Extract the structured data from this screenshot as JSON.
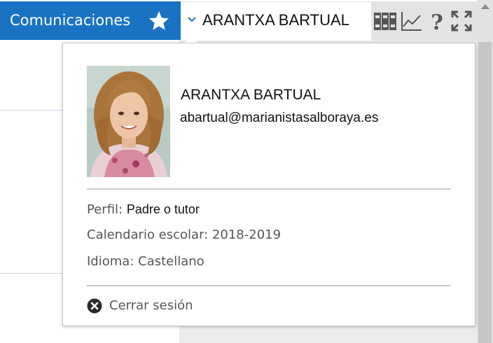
{
  "header": {
    "module_title": "Comunicaciones",
    "user_name": "ARANTXA BARTUAL",
    "colors": {
      "accent": "#1a72c3",
      "toolbar_bg": "#e3e3e3"
    },
    "icons": [
      "star-icon",
      "chevron-down-icon",
      "library-icon",
      "chart-icon",
      "help-icon",
      "fullscreen-icon"
    ]
  },
  "user_popup": {
    "name": "ARANTXA BARTUAL",
    "email": "abartual@marianistasalboraya.es",
    "profile_label": "Perfil:",
    "profile_value": "Padre o tutor",
    "calendar_label": "Calendario escolar:",
    "calendar_value": "2018-2019",
    "language_label": "Idioma:",
    "language_value": "Castellano",
    "logout_label": "Cerrar sesión"
  }
}
